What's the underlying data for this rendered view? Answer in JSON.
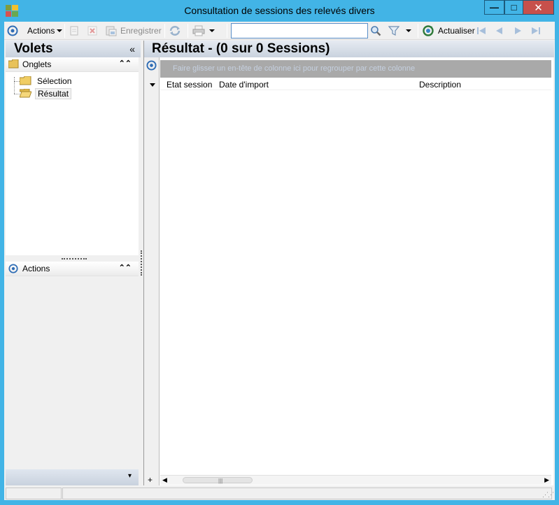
{
  "window": {
    "title": "Consultation de sessions des relevés divers",
    "minimize_glyph": "—",
    "maximize_glyph": "□",
    "close_glyph": "✕",
    "accent": "#42b4e6"
  },
  "toolbar": {
    "actions_label": "Actions",
    "save_label": "Enregistrer",
    "refresh_label": "Actualiser",
    "search_value": "",
    "icons": [
      "target-icon",
      "new-document-icon",
      "delete-icon",
      "save-icon",
      "sync-icon",
      "print-icon",
      "search-icon",
      "filter-icon",
      "refresh-icon",
      "first-page-icon",
      "previous-page-icon",
      "next-page-icon",
      "last-page-icon"
    ]
  },
  "left_panel": {
    "title": "Volets",
    "collapse_glyph": "«",
    "tabs_section": {
      "label": "Onglets",
      "chevron": "⌃⌃",
      "items": [
        {
          "label": "Sélection",
          "selected": false
        },
        {
          "label": "Résultat",
          "selected": true
        }
      ]
    },
    "actions_section": {
      "label": "Actions",
      "chevron": "⌃⌃"
    },
    "bottom_chevron": "▾"
  },
  "result_panel": {
    "title": "Résultat - (0 sur 0 Sessions)",
    "group_hint": "Faire glisser un en-tête de colonne ici pour regrouper par cette colonne",
    "columns": [
      "Etat session",
      "Date d'import",
      "Description"
    ],
    "rows": []
  },
  "statusbar": {
    "cells": [
      "",
      ""
    ]
  }
}
